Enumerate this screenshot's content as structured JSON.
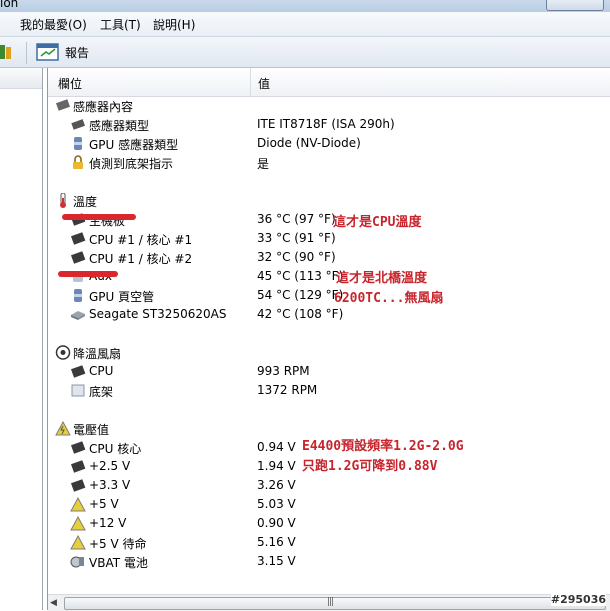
{
  "window": {
    "title_fragment": "ion"
  },
  "menubar": {
    "items": [
      "我的最愛(O)",
      "工具(T)",
      "說明(H)"
    ]
  },
  "toolbar": {
    "report_label": "報告"
  },
  "columns": {
    "field": "欄位",
    "value": "值"
  },
  "groups": {
    "sensor": {
      "title": "感應器內容",
      "items": [
        {
          "label": "感應器類型",
          "value": "ITE IT8718F  (ISA 290h)",
          "icon": "chip-icon"
        },
        {
          "label": "GPU 感應器類型",
          "value": "Diode  (NV-Diode)",
          "icon": "gpu-icon"
        },
        {
          "label": "偵測到底架指示",
          "value": "是",
          "icon": "lock-icon"
        }
      ]
    },
    "temperature": {
      "title": "溫度",
      "items": [
        {
          "label": "主機板",
          "value": "36 °C  (97 °F)",
          "icon": "motherboard-icon"
        },
        {
          "label": "CPU #1 / 核心 #1",
          "value": "33 °C  (91 °F)",
          "icon": "cpu-icon"
        },
        {
          "label": "CPU #1 / 核心 #2",
          "value": "32 °C  (90 °F)",
          "icon": "cpu-icon"
        },
        {
          "label": "Aux",
          "value": "45 °C  (113 °F)",
          "icon": "aux-icon"
        },
        {
          "label": "GPU 頁空管",
          "value": "54 °C  (129 °F)",
          "icon": "gpu-icon"
        },
        {
          "label": "Seagate ST3250620AS",
          "value": "42 °C  (108 °F)",
          "icon": "hdd-icon"
        }
      ]
    },
    "fans": {
      "title": "降溫風扇",
      "items": [
        {
          "label": "CPU",
          "value": "993 RPM",
          "icon": "cpu-icon"
        },
        {
          "label": "底架",
          "value": "1372 RPM",
          "icon": "chassis-icon"
        }
      ]
    },
    "voltage": {
      "title": "電壓值",
      "items": [
        {
          "label": "CPU 核心",
          "value": "0.94 V",
          "icon": "cpu-icon"
        },
        {
          "label": "+2.5 V",
          "value": "1.94 V",
          "icon": "cpu-icon"
        },
        {
          "label": "+3.3 V",
          "value": "3.26 V",
          "icon": "cpu-icon"
        },
        {
          "label": "+5 V",
          "value": "5.03 V",
          "icon": "warning-icon"
        },
        {
          "label": "+12 V",
          "value": "0.90 V",
          "icon": "warning-icon"
        },
        {
          "label": "+5 V 待命",
          "value": "5.16 V",
          "icon": "warning-icon"
        },
        {
          "label": "VBAT 電池",
          "value": "3.15 V",
          "icon": "battery-icon"
        }
      ]
    }
  },
  "annotations": {
    "cpu_temp": "這才是CPU溫度",
    "northbridge": "這才是北橋溫度",
    "gpu_fanless": "6200TC...無風扇",
    "voltage_1": "E4400預設頻率1.2G-2.0G",
    "voltage_2": "只跑1.2G可降到0.88V"
  },
  "watermark": "#295036",
  "colors": {
    "annotation": "#c8242c",
    "header_bg": "#eef1f5",
    "menubar_bg": "#e9eff6"
  }
}
